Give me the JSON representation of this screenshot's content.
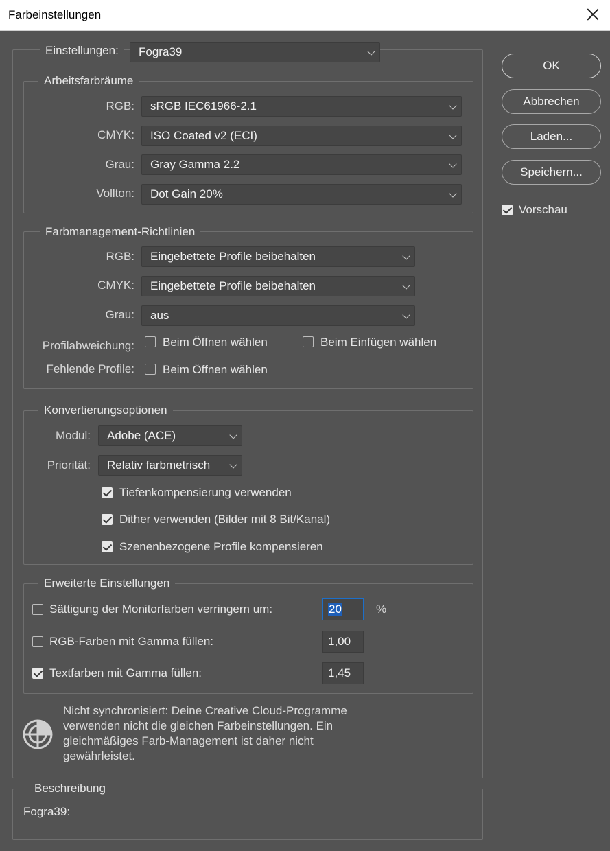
{
  "window": {
    "title": "Farbeinstellungen"
  },
  "settings": {
    "label": "Einstellungen:",
    "value": "Fogra39"
  },
  "working_spaces": {
    "legend": "Arbeitsfarbräume",
    "rgb_label": "RGB:",
    "rgb_value": "sRGB IEC61966-2.1",
    "cmyk_label": "CMYK:",
    "cmyk_value": "ISO Coated v2 (ECI)",
    "gray_label": "Grau:",
    "gray_value": "Gray Gamma 2.2",
    "spot_label": "Vollton:",
    "spot_value": "Dot Gain 20%"
  },
  "policies": {
    "legend": "Farbmanagement-Richtlinien",
    "rgb_label": "RGB:",
    "rgb_value": "Eingebettete Profile beibehalten",
    "cmyk_label": "CMYK:",
    "cmyk_value": "Eingebettete Profile beibehalten",
    "gray_label": "Grau:",
    "gray_value": "aus",
    "mismatch_label": "Profilabweichung:",
    "mismatch_open": "Beim Öffnen wählen",
    "mismatch_paste": "Beim Einfügen wählen",
    "missing_label": "Fehlende Profile:",
    "missing_open": "Beim Öffnen wählen"
  },
  "conversion": {
    "legend": "Konvertierungsoptionen",
    "engine_label": "Modul:",
    "engine_value": "Adobe (ACE)",
    "intent_label": "Priorität:",
    "intent_value": "Relativ farbmetrisch",
    "bpc": "Tiefenkompensierung verwenden",
    "dither": "Dither verwenden (Bilder mit 8 Bit/Kanal)",
    "scene": "Szenenbezogene Profile kompensieren"
  },
  "advanced": {
    "legend": "Erweiterte Einstellungen",
    "desaturate": "Sättigung der Monitorfarben verringern um:",
    "desaturate_value": "20",
    "percent": "%",
    "blend_rgb": "RGB-Farben mit Gamma füllen:",
    "blend_rgb_value": "1,00",
    "blend_text": "Textfarben mit Gamma füllen:",
    "blend_text_value": "1,45"
  },
  "sync_message": "Nicht synchronisiert: Deine Creative Cloud-Programme verwenden nicht die gleichen Farbeinstellungen. Ein gleichmäßiges Farb-Management ist daher nicht gewährleistet.",
  "description": {
    "legend": "Beschreibung",
    "text": "Fogra39:"
  },
  "buttons": {
    "ok": "OK",
    "cancel": "Abbrechen",
    "load": "Laden...",
    "save": "Speichern..."
  },
  "preview": {
    "label": "Vorschau"
  }
}
